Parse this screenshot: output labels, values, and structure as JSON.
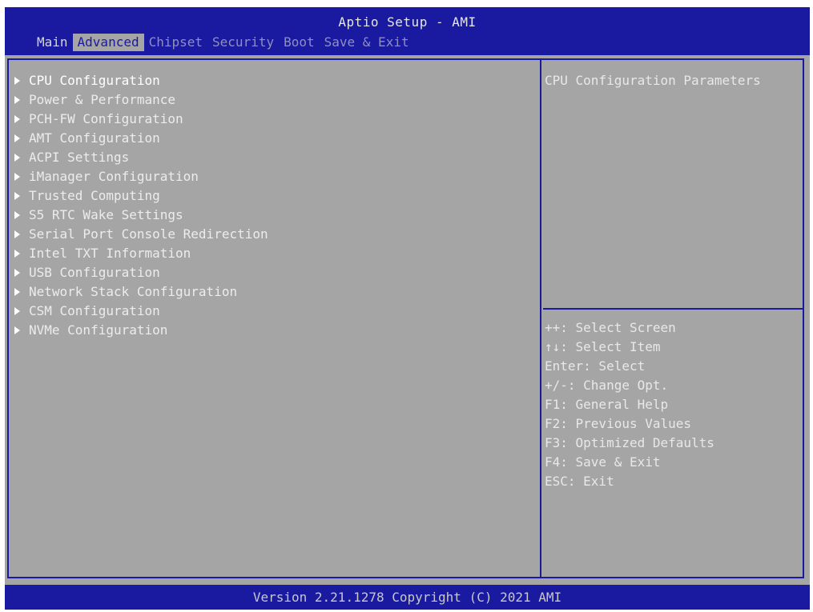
{
  "header": {
    "title": "Aptio Setup - AMI",
    "tabs": [
      {
        "label": "Main"
      },
      {
        "label": "Advanced"
      },
      {
        "label": "Chipset"
      },
      {
        "label": "Security"
      },
      {
        "label": "Boot"
      },
      {
        "label": "Save & Exit"
      }
    ],
    "active_tab": "Advanced"
  },
  "menu": {
    "items": [
      {
        "label": "CPU Configuration"
      },
      {
        "label": "Power & Performance"
      },
      {
        "label": "PCH-FW Configuration"
      },
      {
        "label": "AMT Configuration"
      },
      {
        "label": "ACPI Settings"
      },
      {
        "label": "iManager Configuration"
      },
      {
        "label": "Trusted Computing"
      },
      {
        "label": "S5 RTC Wake Settings"
      },
      {
        "label": "Serial Port Console Redirection"
      },
      {
        "label": "Intel TXT Information"
      },
      {
        "label": "USB Configuration"
      },
      {
        "label": "Network Stack Configuration"
      },
      {
        "label": "CSM Configuration"
      },
      {
        "label": "NVMe Configuration"
      }
    ],
    "selected_index": 0
  },
  "help": {
    "description": "CPU Configuration Parameters",
    "keys": [
      "++: Select Screen",
      "↑↓: Select Item",
      "Enter: Select",
      "+/-: Change Opt.",
      "F1: General Help",
      "F2: Previous Values",
      "F3: Optimized Defaults",
      "F4: Save & Exit",
      "ESC: Exit"
    ]
  },
  "footer": {
    "text": "Version 2.21.1278 Copyright (C) 2021 AMI"
  },
  "colors": {
    "frame_blue": "#1a1aa0",
    "panel_gray": "#a5a5a5",
    "text": "#e8e8e8"
  },
  "icons": {
    "menu_arrow": "right-triangle-icon"
  }
}
